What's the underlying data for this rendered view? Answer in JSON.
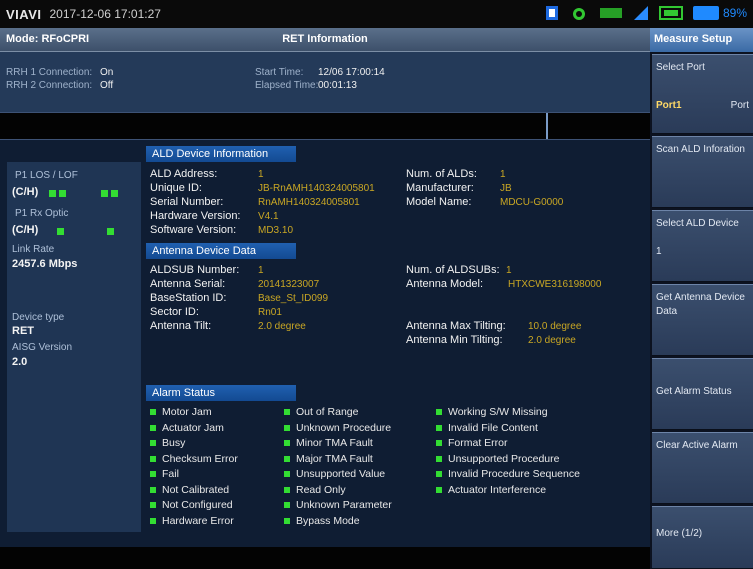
{
  "topbar": {
    "brand": "VIAVI",
    "datetime": "2017-12-06 17:01:27",
    "battery_pct": "89%"
  },
  "modebar": {
    "mode": "Mode: RFoCPRI",
    "title": "RET Information"
  },
  "connection": {
    "rrh1_label": "RRH 1 Connection:",
    "rrh1_val": "On",
    "rrh2_label": "RRH 2 Connection:",
    "rrh2_val": "Off",
    "start_label": "Start Time:",
    "start_val": "12/06 17:00:14",
    "elapsed_label": "Elapsed Time:",
    "elapsed_val": "00:01:13"
  },
  "leftpanel": {
    "p1_los_lof": "P1   LOS  /  LOF",
    "chi1": "(C/H)",
    "p1_rx": "P1    Rx Optic",
    "chi2": "(C/H)",
    "link_rate_label": "Link Rate",
    "link_rate_val": "2457.6 Mbps",
    "device_type_label": "Device type",
    "device_type_val": "RET",
    "aisg_label": "AISG Version",
    "aisg_val": "2.0"
  },
  "ald": {
    "header": "ALD Device Information",
    "address_label": "ALD Address:",
    "address_val": "1",
    "unique_label": "Unique ID:",
    "unique_val": "JB-RnAMH140324005801",
    "serial_label": "Serial Number:",
    "serial_val": "RnAMH140324005801",
    "hw_label": "Hardware Version:",
    "hw_val": "V4.1",
    "sw_label": "Software Version:",
    "sw_val": "MD3.10",
    "num_alds_label": "Num. of ALDs:",
    "num_alds_val": "1",
    "manuf_label": "Manufacturer:",
    "manuf_val": "JB",
    "model_label": "Model Name:",
    "model_val": "MDCU-G0000"
  },
  "antenna": {
    "header": "Antenna Device Data",
    "aldsub_label": "ALDSUB Number:",
    "aldsub_val": "1",
    "serial_label": "Antenna Serial:",
    "serial_val": "20141323007",
    "bs_label": "BaseStation ID:",
    "bs_val": "Base_St_ID099",
    "sector_label": "Sector ID:",
    "sector_val": "Rn01",
    "tilt_label": "Antenna Tilt:",
    "tilt_val": "2.0 degree",
    "num_aldsubs_label": "Num. of ALDSUBs:",
    "num_aldsubs_val": "1",
    "model_label": "Antenna Model:",
    "model_val": "HTXCWE316198000",
    "max_tilt_label": "Antenna Max Tilting:",
    "max_tilt_val": "10.0 degree",
    "min_tilt_label": "Antenna Min Tilting:",
    "min_tilt_val": "2.0 degree"
  },
  "alarm": {
    "header": "Alarm Status",
    "col1": [
      "Motor Jam",
      "Actuator Jam",
      "Busy",
      "Checksum Error",
      "Fail",
      "Not Calibrated",
      "Not Configured",
      "Hardware Error"
    ],
    "col2": [
      "Out of Range",
      "Unknown Procedure",
      "Minor TMA Fault",
      "Major TMA Fault",
      "Unsupported Value",
      "Read Only",
      "Unknown Parameter",
      "Bypass Mode"
    ],
    "col3": [
      "Working S/W Missing",
      "Invalid File Content",
      "Format Error",
      "Unsupported Procedure",
      "Invalid Procedure Sequence",
      "Actuator Interference"
    ]
  },
  "softkeys": {
    "header": "Measure Setup",
    "select_port": "Select Port",
    "port1": "Port1",
    "port2": "Port",
    "scan_ald": "Scan ALD Inforation",
    "select_ald_device": "Select ALD Device",
    "select_ald_val": "1",
    "get_antenna": "Get Antenna Device Data",
    "get_alarm": "Get Alarm Status",
    "clear_alarm": "Clear Active Alarm",
    "more": "More (1/2)"
  },
  "colors": {
    "value_gold": "#c9a724",
    "led_green": "#33dd33",
    "section_blue": "#134a92"
  }
}
